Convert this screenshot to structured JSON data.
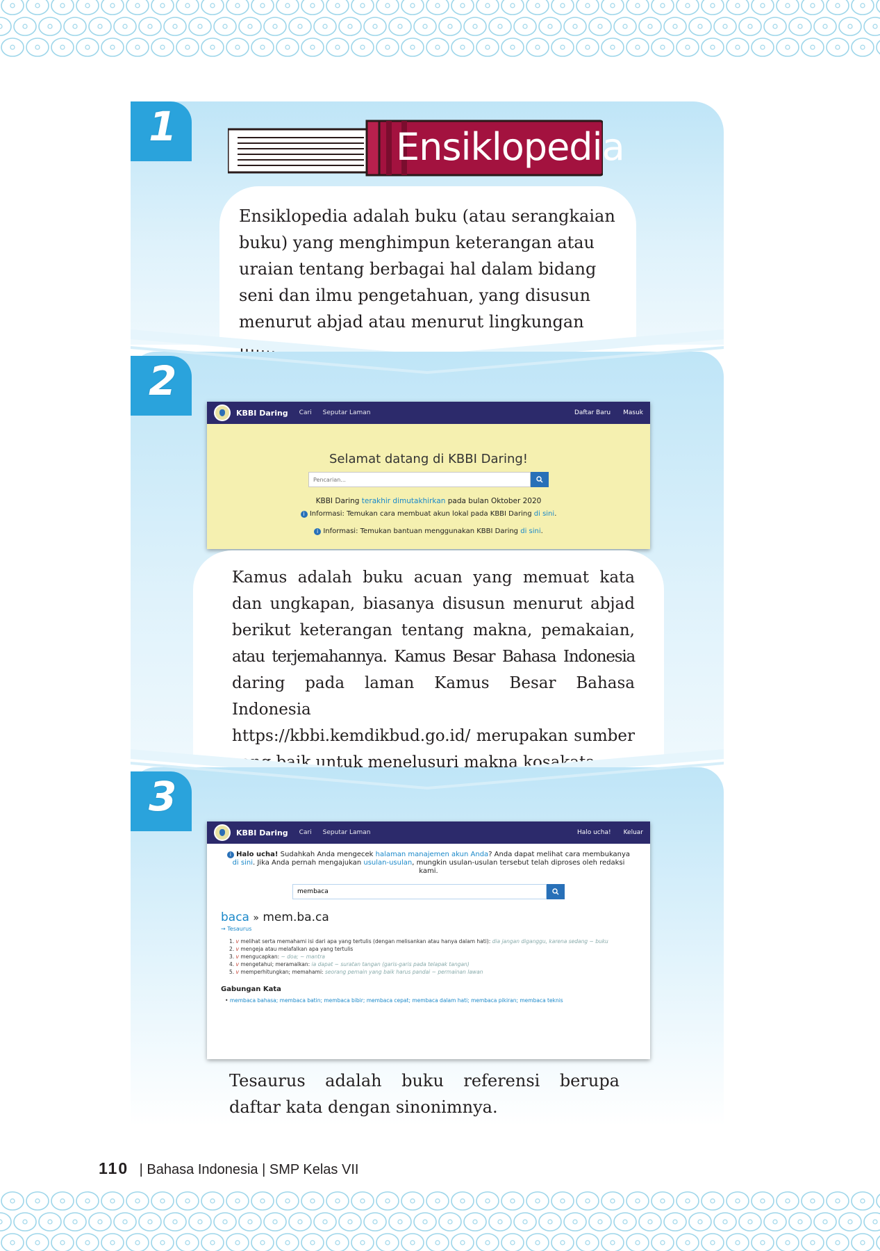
{
  "section1": {
    "number": "1",
    "book_title": "Ensiklopedia",
    "text": "Ensiklopedia adalah buku (atau serangkaian buku) yang menghimpun keterangan atau uraian tentang berbagai hal dalam bidang seni dan ilmu pengetahuan, yang disusun menurut abjad atau menurut lingkungan ilmu."
  },
  "section2": {
    "number": "2",
    "kbbi": {
      "brand": "KBBI Daring",
      "nav_search": "Cari",
      "nav_about": "Seputar Laman",
      "nav_register": "Daftar Baru",
      "nav_login": "Masuk",
      "welcome": "Selamat datang di KBBI Daring!",
      "search_placeholder": "Pencarian...",
      "update_prefix": "KBBI Daring",
      "update_link": "terakhir dimutakhirkan",
      "update_suffix": "pada bulan Oktober 2020",
      "info1_prefix": "Informasi: Temukan cara membuat akun lokal pada KBBI Daring",
      "info1_link": "di sini",
      "info2_prefix": "Informasi: Temukan bantuan menggunakan KBBI Daring",
      "info2_link": "di sini"
    },
    "text_lines": [
      "Kamus adalah buku acuan yang memuat kata",
      "dan ungkapan, biasanya disusun menurut abjad",
      "berikut keterangan tentang makna, pemakaian,",
      "atau terjemahannya. Kamus Besar Bahasa Indonesia",
      "daring pada laman Kamus Besar Bahasa Indonesia",
      "https://kbbi.kemdikbud.go.id/ merupakan sumber",
      "yang baik untuk menelusuri makna kosakata."
    ]
  },
  "section3": {
    "number": "3",
    "kbbi": {
      "brand": "KBBI Daring",
      "nav_search": "Cari",
      "nav_about": "Seputar Laman",
      "nav_user": "Halo ucha!",
      "nav_logout": "Keluar",
      "notice_bold": "Halo ucha!",
      "notice_1": "Sudahkah Anda mengecek",
      "notice_link1": "halaman manajemen akun Anda",
      "notice_2": "? Anda dapat melihat cara membukanya",
      "notice_link2": "di sini",
      "notice_3": ". Jika Anda pernah mengajukan",
      "notice_link3": "usulan-usulan",
      "notice_4": ", mungkin usulan-usulan tersebut telah diproses oleh redaksi kami.",
      "search_value": "membaca",
      "root": "baca",
      "sep": "»",
      "headword": "mem.ba.ca",
      "thesaurus_link": "→ Tesaurus",
      "senses": [
        {
          "n": "1.",
          "text": "melihat serta memahami isi dari apa yang tertulis (dengan melisankan atau hanya dalam hati):",
          "example": "dia jangan diganggu, karena sedang ~ buku"
        },
        {
          "n": "2.",
          "text": "mengeja atau melafalkan apa yang tertulis",
          "example": ""
        },
        {
          "n": "3.",
          "text": "mengucapkan:",
          "example": "~ doa; ~ mantra"
        },
        {
          "n": "4.",
          "text": "mengetahui; meramalkan:",
          "example": "ia dapat ~ suratan tangan (garis-garis pada telapak tangan)"
        },
        {
          "n": "5.",
          "text": "memperhitungkan; memahami:",
          "example": "seorang pemain yang baik harus pandai ~ permainan lawan"
        }
      ],
      "sense_marker": "v",
      "gabungan_title": "Gabungan Kata",
      "gabungan_list": "membaca bahasa; membaca batin; membaca bibir; membaca cepat; membaca dalam hati; membaca pikiran; membaca teknis"
    },
    "text_lines": [
      "Tesaurus adalah buku referensi berupa",
      "daftar kata dengan sinonimnya."
    ]
  },
  "footer": {
    "page_number": "110",
    "text": "| Bahasa Indonesia | SMP Kelas VII"
  },
  "colors": {
    "accent_blue": "#2aa3dc",
    "panel_blue": "#bfe5f7",
    "kbbi_nav": "#2c2a6b",
    "kbbi_yellow": "#f5f0b0",
    "book_red": "#a3123f"
  }
}
